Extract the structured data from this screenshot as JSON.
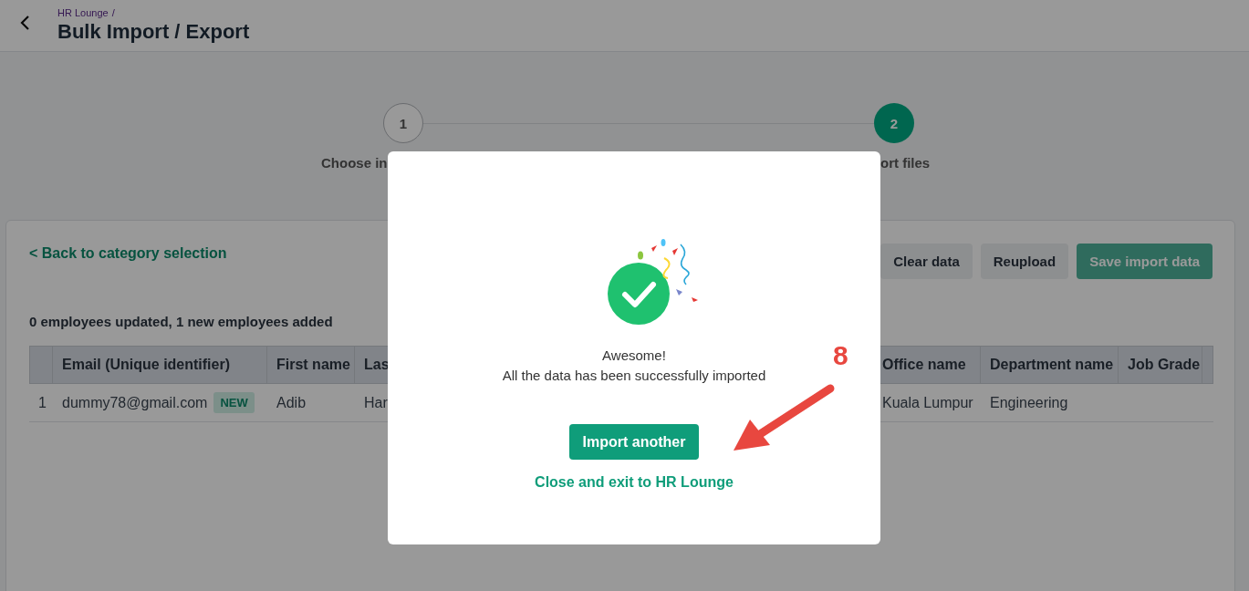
{
  "header": {
    "breadcrumb": "HR Lounge",
    "separator": "/",
    "title": "Bulk Import / Export"
  },
  "stepper": {
    "steps": [
      {
        "number": "1",
        "label": "Choose in",
        "selected": false
      },
      {
        "number": "2",
        "label": "ort files",
        "selected": true
      }
    ]
  },
  "back_link": "< Back to category selection",
  "actions": [
    {
      "label": "Clear data",
      "kind": "secondary",
      "disabled": false
    },
    {
      "label": "Reupload",
      "kind": "secondary",
      "disabled": false
    },
    {
      "label": "Save import data",
      "kind": "primary",
      "disabled": true
    }
  ],
  "summary": "0 employees updated, 1 new employees added",
  "table": {
    "columns": [
      "Email (Unique identifier)",
      "First name",
      "Las",
      "Office name",
      "Department name",
      "Job Grade"
    ],
    "rows": [
      {
        "number": "1",
        "badge": "NEW",
        "cells": [
          "dummy78@gmail.com",
          "Adib",
          "Har",
          "Kuala Lumpur",
          "Engineering"
        ]
      }
    ]
  },
  "modal": {
    "title": "Awesome!",
    "message": "All the data has been successfully imported",
    "button": "Import another",
    "link": "Close and exit to HR Lounge"
  },
  "annotation": {
    "label": "8"
  }
}
